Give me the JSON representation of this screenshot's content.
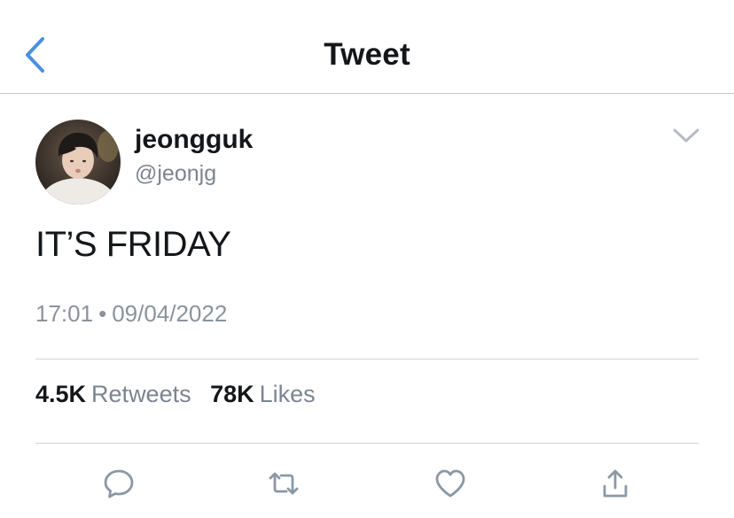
{
  "header": {
    "title": "Tweet",
    "back_icon": "chevron-left-icon",
    "accent_color": "#4a90e2"
  },
  "author": {
    "name": "jeongguk",
    "handle": "@jeonjg"
  },
  "tweet": {
    "text": "IT’S FRIDAY",
    "time": "17:01",
    "separator": "•",
    "date": "09/04/2022"
  },
  "stats": {
    "retweets_count": "4.5K",
    "retweets_label": "Retweets",
    "likes_count": "78K",
    "likes_label": "Likes"
  },
  "actions": {
    "reply_icon": "reply-bubble-icon",
    "retweet_icon": "retweet-icon",
    "like_icon": "heart-icon",
    "share_icon": "share-icon",
    "icon_color": "#8b98a5"
  }
}
